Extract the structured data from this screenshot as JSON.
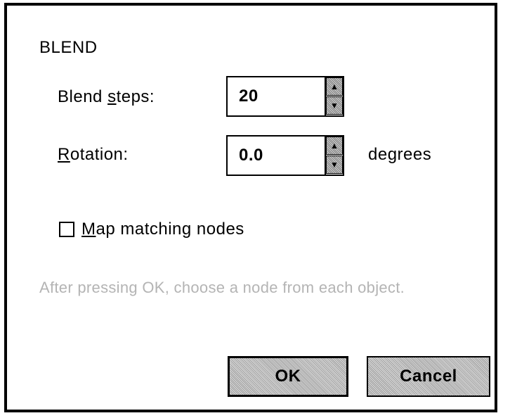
{
  "dialog": {
    "title": "BLEND",
    "blend_steps": {
      "label_before": "Blend ",
      "label_mnemonic": "s",
      "label_after": "teps:",
      "value": "20"
    },
    "rotation": {
      "label_mnemonic": "R",
      "label_after": "otation:",
      "value": "0.0",
      "units": "degrees"
    },
    "map_matching_nodes": {
      "label_mnemonic": "M",
      "label_after": "ap matching nodes",
      "checked": false
    },
    "hint": "After pressing OK, choose a node from each object.",
    "buttons": {
      "ok": "OK",
      "cancel": "Cancel"
    }
  },
  "colors": {
    "disabled_text": "#b4b4b4",
    "border": "#000000",
    "background": "#ffffff"
  },
  "icons": {
    "spin_up": "spin-up-arrow-icon",
    "spin_down": "spin-down-arrow-icon",
    "checkbox": "checkbox-unchecked-icon"
  }
}
